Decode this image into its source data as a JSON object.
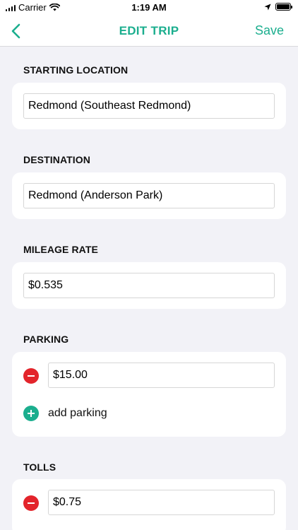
{
  "status_bar": {
    "carrier": "Carrier",
    "time": "1:19 AM"
  },
  "nav": {
    "title": "EDIT TRIP",
    "save_label": "Save",
    "accent_color": "#1bae8e"
  },
  "sections": {
    "starting_location": {
      "label": "STARTING LOCATION",
      "value": "Redmond (Southeast Redmond)"
    },
    "destination": {
      "label": "DESTINATION",
      "value": "Redmond (Anderson Park)"
    },
    "mileage_rate": {
      "label": "MILEAGE RATE",
      "value": "$0.535"
    },
    "parking": {
      "label": "PARKING",
      "items": [
        "$15.00"
      ],
      "add_label": "add parking"
    },
    "tolls": {
      "label": "TOLLS",
      "items": [
        "$0.75"
      ]
    }
  },
  "colors": {
    "remove": "#e3242b",
    "add": "#1bae8e",
    "background": "#f2f2f7"
  }
}
